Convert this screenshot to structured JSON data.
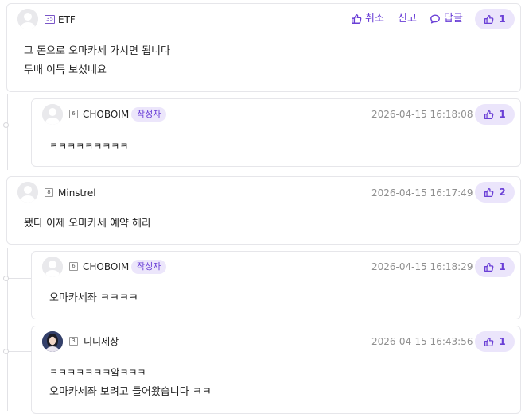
{
  "comments": [
    {
      "username": "ETF",
      "level": "35",
      "likes": "1",
      "actions": {
        "cancel": "취소",
        "report": "신고",
        "reply": "답글"
      },
      "lines": [
        "그 돈으로 오마카세 가시면 됩니다",
        "두배 이득 보셨네요"
      ]
    },
    {
      "username": "CHOBOIM",
      "level": "6",
      "badge": "작성자",
      "time": "2026-04-15 16:18:08",
      "likes": "1",
      "lines": [
        "ㅋㅋㅋㅋㅋㅋㅋㅋㅋ"
      ]
    },
    {
      "username": "Minstrel",
      "level": "8",
      "time": "2026-04-15 16:17:49",
      "likes": "2",
      "lines": [
        "됐다 이제 오마카세 예약 해라"
      ]
    },
    {
      "username": "CHOBOIM",
      "level": "6",
      "badge": "작성자",
      "time": "2026-04-15 16:18:29",
      "likes": "1",
      "lines": [
        "오마카세좌 ㅋㅋㅋㅋ"
      ]
    },
    {
      "username": "니니세상",
      "level": "3",
      "time": "2026-04-15 16:43:56",
      "likes": "1",
      "lines": [
        "ㅋㅋㅋㅋㅋㅋㅋ앜ㅋㅋㅋ",
        "오마카세좌 보려고 들어왔습니다 ㅋㅋ"
      ]
    }
  ],
  "icons": {
    "like": "thumbs-up-icon",
    "cancel": "thumbs-up-icon",
    "reply": "speech-bubble-icon",
    "default_avatar": "person-icon"
  },
  "colors": {
    "accent": "#6a3fd6",
    "accent_bg": "#ebe5fb",
    "time": "#8f8f8f",
    "border": "#e6e6ea"
  }
}
